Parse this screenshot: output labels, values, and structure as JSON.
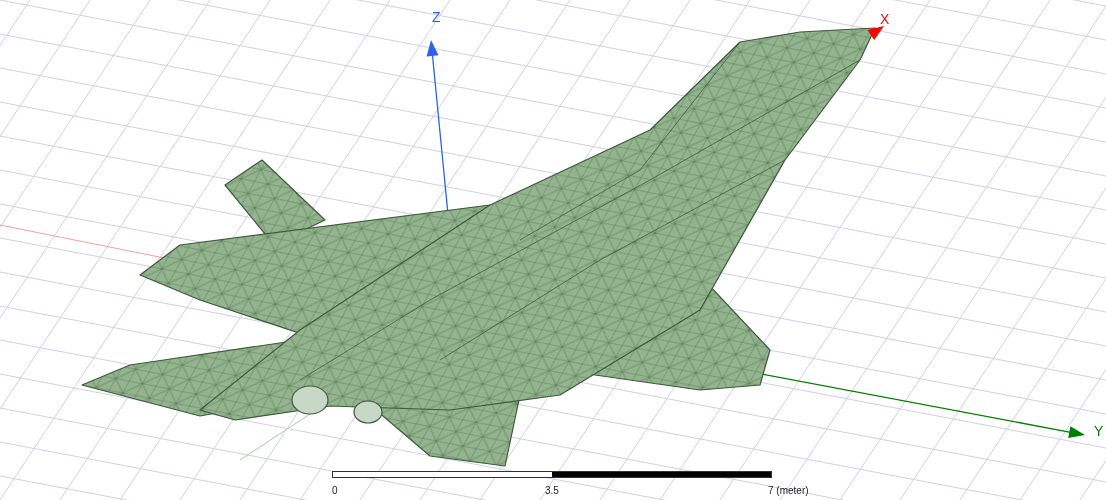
{
  "axes": [
    {
      "label": "X",
      "color": "#ff0000"
    },
    {
      "label": "Y",
      "color": "#008000"
    },
    {
      "label": "Z",
      "color": "#2f62e8"
    }
  ],
  "scale_bar": {
    "ticks": [
      "0",
      "3.5",
      "7 (meter)"
    ]
  }
}
